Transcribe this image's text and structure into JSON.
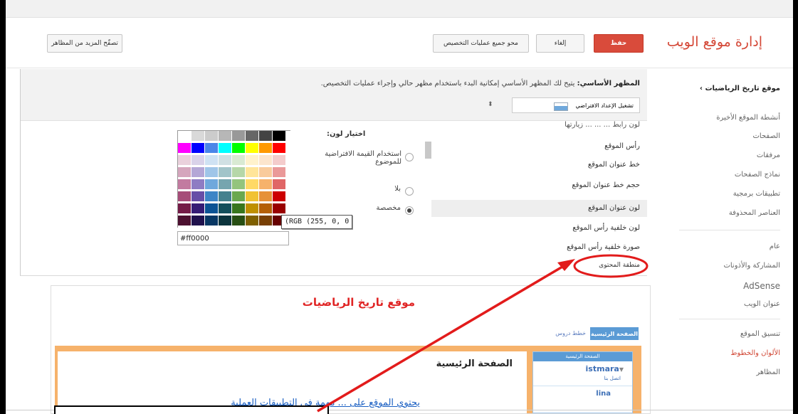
{
  "header": {
    "site_manage_title": "إدارة موقع الويب",
    "save_label": "حفظ",
    "cancel_label": "إلغاء",
    "clear_custom_label": "محو جميع عمليات التخصيص",
    "browse_themes_label": "تصفّح المزيد من المظاهر"
  },
  "sidebar": {
    "site_link": "موقع تاريخ الرياضيات",
    "items": [
      "أنشطة الموقع الأخيرة",
      "الصفحات",
      "مرفقات",
      "نماذج الصفحات",
      "تطبيقات برمجية",
      "العناصر المحذوفة",
      "عام",
      "المشاركة والأذونات",
      "AdSense",
      "عنوان الويب",
      "تنسيق الموقع",
      "الألوان والخطوط",
      "المظاهر"
    ]
  },
  "theme": {
    "desc_bold": "المظهر الأساسي:",
    "desc_text": " يتيح لك المظهر الأساسي إمكانية البدء باستخدام مظهر حالي وإجراء عمليات التخصيص.",
    "select_label": "تشغيل الإعداد الافتراضي",
    "options": [
      "لون رابط ... ... ... زيارتها",
      "رأس الموقع",
      "خط عنوان الموقع",
      "حجم خط عنوان الموقع",
      "لون عنوان الموقع",
      "لون خلفية رأس الموقع",
      "صورة خلفية رأس الموقع",
      "منطقة المحتوى"
    ]
  },
  "color_chooser": {
    "title": "اختيار لون:",
    "radio_default": "استخدام القيمة الافتراضية للموضوع",
    "radio_none": "بلا",
    "radio_custom": "مخصصة",
    "hex_value": "#ff0000",
    "tooltip": "(RGB (255, 0, 0",
    "palette_rows": [
      [
        "#000000",
        "#434343",
        "#666666",
        "#999999",
        "#b7b7b7",
        "#cccccc",
        "#d9d9d9",
        "#ffffff"
      ],
      [
        "#ff0000",
        "#ff9900",
        "#ffff00",
        "#00ff00",
        "#00ffff",
        "#4a86e8",
        "#0000ff",
        "#ff00ff"
      ],
      [
        "#f4cccc",
        "#fce5cd",
        "#fff2cc",
        "#d9ead3",
        "#d0e0e3",
        "#cfe2f3",
        "#d9d2e9",
        "#ead1dc"
      ],
      [
        "#ea9999",
        "#f9cb9c",
        "#ffe599",
        "#b6d7a8",
        "#a2c4c9",
        "#9fc5e8",
        "#b4a7d6",
        "#d5a6bd"
      ],
      [
        "#e06666",
        "#f6b26b",
        "#ffd966",
        "#93c47d",
        "#76a5af",
        "#6fa8dc",
        "#8e7cc3",
        "#c27ba0"
      ],
      [
        "#cc0000",
        "#e69138",
        "#f1c232",
        "#6aa84f",
        "#45818e",
        "#3d85c6",
        "#674ea7",
        "#a64d79"
      ],
      [
        "#990000",
        "#b45f06",
        "#bf9000",
        "#38761d",
        "#134f5c",
        "#0b5394",
        "#351c75",
        "#741b47"
      ],
      [
        "#660000",
        "#783f04",
        "#7f6000",
        "#274e13",
        "#0c343d",
        "#073763",
        "#20124d",
        "#4c1130"
      ]
    ]
  },
  "preview": {
    "site_title": "موقع تاريخ الرياضيات",
    "tab_home": "الصفحة الرئيسية",
    "tab_lessons": "خطط دروس",
    "page_heading": "الصفحة الرئيسية",
    "content_text": "يحتوي الموقع على ... مهمة في التطبيقات العملية",
    "side_header": "الصفحة الرئيسية",
    "side_user": "istmara",
    "side_contact": "اتصل بنا",
    "side_user2": "lina"
  },
  "colors": {
    "accent_red": "#d94b3b",
    "annotation_red": "#e21b1b",
    "preview_blue": "#5b9bd5",
    "preview_orange": "#f6b26b"
  }
}
